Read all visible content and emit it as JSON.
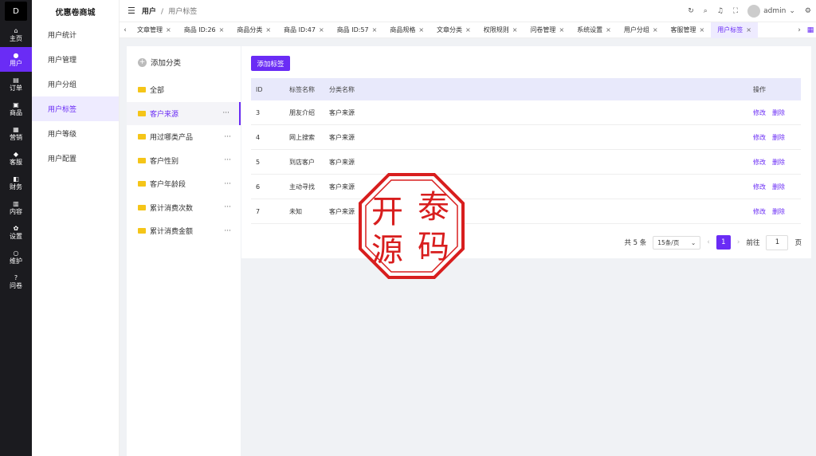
{
  "app": {
    "brand": "优惠卷商城",
    "logo_text": "D"
  },
  "rail": [
    {
      "icon": "⌂",
      "label": "主页",
      "name": "home"
    },
    {
      "icon": "●",
      "label": "用户",
      "name": "user",
      "active": true
    },
    {
      "icon": "▤",
      "label": "订单",
      "name": "order"
    },
    {
      "icon": "▣",
      "label": "商品",
      "name": "product"
    },
    {
      "icon": "▦",
      "label": "营销",
      "name": "marketing"
    },
    {
      "icon": "◆",
      "label": "客服",
      "name": "service"
    },
    {
      "icon": "◧",
      "label": "财务",
      "name": "finance"
    },
    {
      "icon": "▥",
      "label": "内容",
      "name": "content"
    },
    {
      "icon": "✿",
      "label": "设置",
      "name": "settings"
    },
    {
      "icon": "○",
      "label": "维护",
      "name": "maintain"
    },
    {
      "icon": "?",
      "label": "问卷",
      "name": "survey"
    }
  ],
  "sidebar": [
    {
      "label": "用户统计",
      "name": "stats"
    },
    {
      "label": "用户管理",
      "name": "manage"
    },
    {
      "label": "用户分组",
      "name": "group"
    },
    {
      "label": "用户标签",
      "name": "tag",
      "active": true
    },
    {
      "label": "用户等级",
      "name": "level"
    },
    {
      "label": "用户配置",
      "name": "config"
    }
  ],
  "header": {
    "crumb_root": "用户",
    "crumb_sep": "/",
    "crumb_current": "用户标签",
    "user": "admin"
  },
  "tabs": [
    {
      "label": "文章管理"
    },
    {
      "label": "商品 ID:26"
    },
    {
      "label": "商品分类"
    },
    {
      "label": "商品 ID:47"
    },
    {
      "label": "商品 ID:57"
    },
    {
      "label": "商品规格"
    },
    {
      "label": "文章分类"
    },
    {
      "label": "权限规则"
    },
    {
      "label": "问卷管理"
    },
    {
      "label": "系统设置"
    },
    {
      "label": "用户分组"
    },
    {
      "label": "客服管理"
    },
    {
      "label": "用户标签",
      "active": true
    }
  ],
  "categories": {
    "add_label": "添加分类",
    "items": [
      {
        "label": "全部"
      },
      {
        "label": "客户来源",
        "active": true
      },
      {
        "label": "用过哪类产品"
      },
      {
        "label": "客户性别"
      },
      {
        "label": "客户年龄段"
      },
      {
        "label": "累计消费次数"
      },
      {
        "label": "累计消费金额"
      }
    ]
  },
  "main": {
    "add_button": "添加标签",
    "columns": [
      "ID",
      "标签名称",
      "分类名称",
      "操作"
    ],
    "rows": [
      {
        "id": "3",
        "name": "朋友介绍",
        "category": "客户来源"
      },
      {
        "id": "4",
        "name": "网上搜索",
        "category": "客户来源"
      },
      {
        "id": "5",
        "name": "到店客户",
        "category": "客户来源"
      },
      {
        "id": "6",
        "name": "主动寻找",
        "category": "客户来源"
      },
      {
        "id": "7",
        "name": "未知",
        "category": "客户来源"
      }
    ],
    "edit_label": "修改",
    "delete_label": "删除"
  },
  "pagination": {
    "total": "共 5 条",
    "page_size": "15条/页",
    "current_page": "1",
    "goto_label": "前往",
    "goto_value": "1",
    "page_unit": "页"
  },
  "watermark": {
    "line1a": "开",
    "line1b": "泰",
    "line2a": "源",
    "line2b": "码",
    "color": "#d81e1e"
  }
}
